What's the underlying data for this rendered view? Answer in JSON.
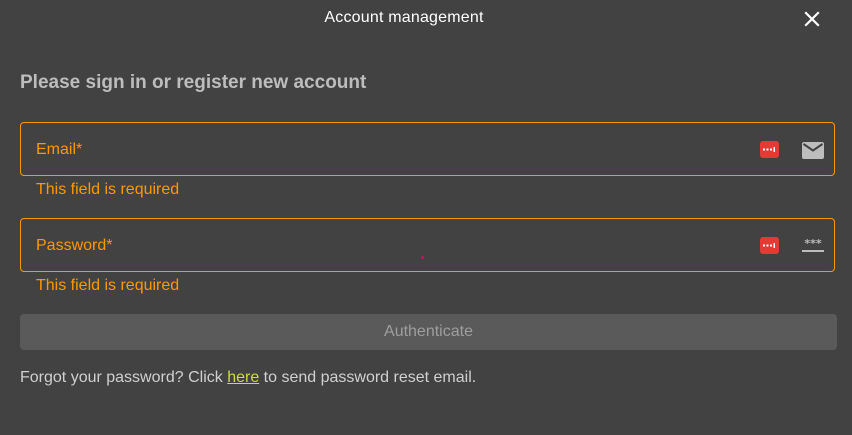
{
  "dialog": {
    "title": "Account management",
    "close_icon": "close-icon"
  },
  "heading": "Please sign in or register new account",
  "email": {
    "label": "Email*",
    "value": "",
    "error": "This field is required",
    "password_manager_icon": "password-manager-icon",
    "trailing_icon": "envelope-icon"
  },
  "password": {
    "label": "Password*",
    "value": "",
    "error": "This field is required",
    "password_manager_icon": "password-manager-icon",
    "trailing_icon": "password-dots-icon"
  },
  "authenticate_button": "Authenticate",
  "forgot": {
    "prefix": "Forgot your password? Click ",
    "link": "here",
    "suffix": " to send password reset email."
  },
  "colors": {
    "background": "#424242",
    "accent": "#ff9800",
    "link": "#cddc39",
    "password_manager": "#e53935"
  }
}
